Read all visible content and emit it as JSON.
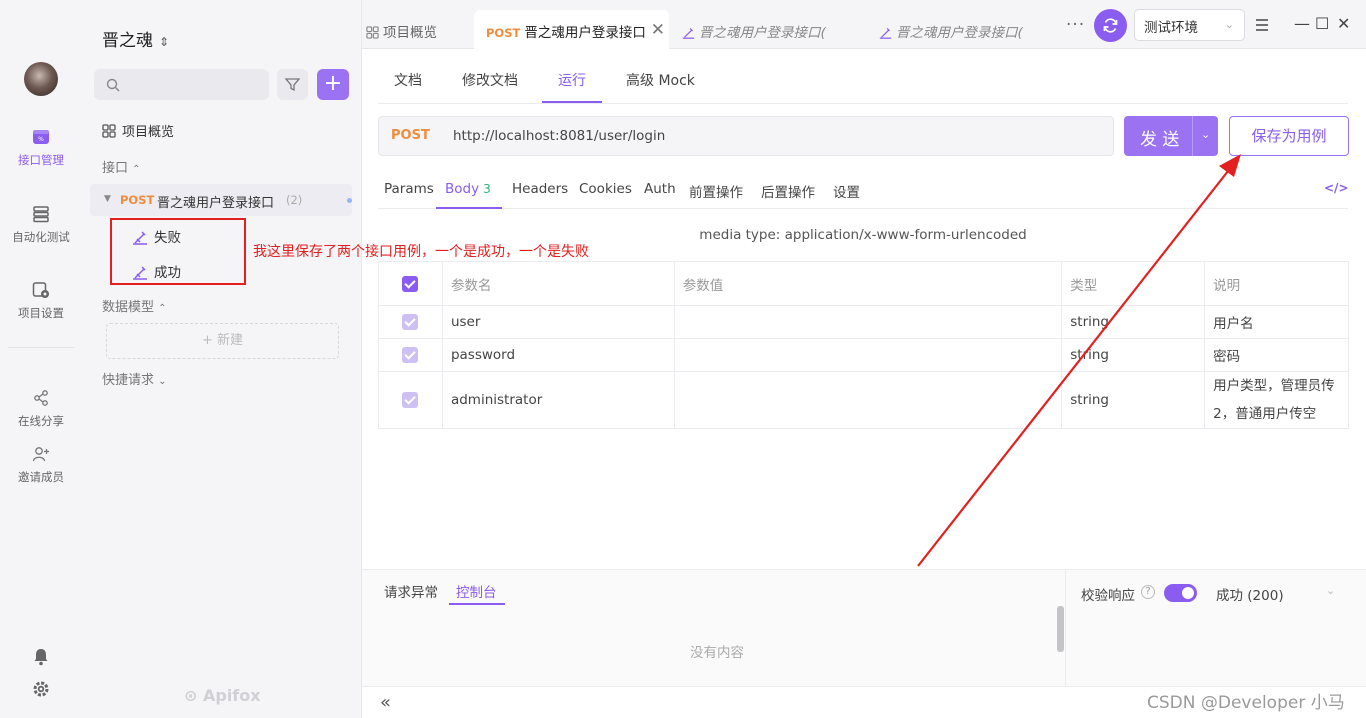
{
  "app": {
    "project_name": "晋之魂",
    "brand": "Apifox"
  },
  "rail": {
    "items": [
      {
        "label": "接口管理",
        "icon": "api-management-icon",
        "active": true
      },
      {
        "label": "自动化测试",
        "icon": "automation-test-icon"
      },
      {
        "label": "项目设置",
        "icon": "project-settings-icon"
      },
      {
        "label": "在线分享",
        "icon": "share-icon"
      },
      {
        "label": "邀请成员",
        "icon": "invite-member-icon"
      }
    ]
  },
  "tree": {
    "overview": "项目概览",
    "section_api": "接口",
    "api": {
      "method": "POST",
      "name": "晋之魂用户登录接口",
      "count": "(2)"
    },
    "cases": [
      "失败",
      "成功"
    ],
    "section_model": "数据模型",
    "new_label": "+ 新建",
    "section_quick": "快捷请求"
  },
  "annotation": {
    "note": "我这里保存了两个接口用例，一个是成功，一个是失败",
    "color": "#e32020"
  },
  "tabs": {
    "overview": "项目概览",
    "active_method": "POST",
    "active_title": "晋之魂用户登录接口",
    "case_tab_1": "晋之魂用户登录接口(",
    "case_tab_2": "晋之魂用户登录接口(",
    "more": "···"
  },
  "env": {
    "label": "测试环境"
  },
  "subtabs": [
    "文档",
    "修改文档",
    "运行",
    "高级 Mock"
  ],
  "request": {
    "method": "POST",
    "url": "http://localhost:8081/user/login",
    "send_label": "发 送",
    "save_case_label": "保存为用例"
  },
  "param_tabs": {
    "params": "Params",
    "body": "Body",
    "body_count": "3",
    "headers": "Headers",
    "cookies": "Cookies",
    "auth": "Auth",
    "pre": "前置操作",
    "post": "后置操作",
    "settings": "设置"
  },
  "media_type": "media type: application/x-www-form-urlencoded",
  "table": {
    "headers": {
      "name": "参数名",
      "value": "参数值",
      "type": "类型",
      "desc": "说明"
    },
    "rows": [
      {
        "name": "user",
        "value": "",
        "type": "string",
        "desc": "用户名"
      },
      {
        "name": "password",
        "value": "",
        "type": "string",
        "desc": "密码"
      },
      {
        "name": "administrator",
        "value": "",
        "type": "string",
        "desc": "用户类型，管理员传2，普通用户传空"
      }
    ]
  },
  "bottom": {
    "tab_error": "请求异常",
    "tab_console": "控制台",
    "empty": "没有内容",
    "verify_label": "校验响应",
    "response_label": "成功 (200)"
  },
  "statusbar": {
    "watermark": "CSDN @Developer 小马"
  },
  "colors": {
    "accent": "#8a5cf0",
    "method": "#f08c3c",
    "annotation": "#e32020"
  }
}
